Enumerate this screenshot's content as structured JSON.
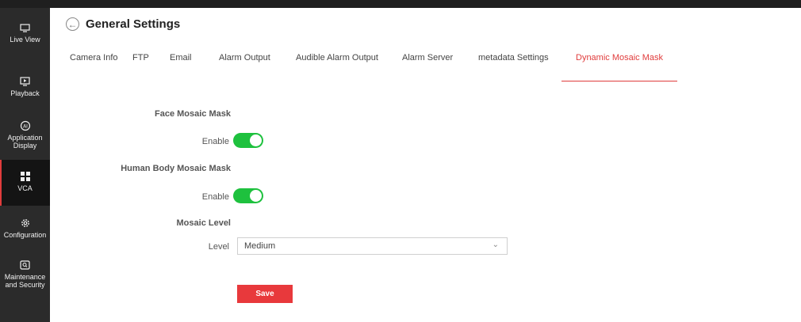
{
  "sidebar": {
    "items": [
      {
        "label_lines": [
          "Live View"
        ],
        "icon": "monitor-icon"
      },
      {
        "label_lines": [
          "Playback"
        ],
        "icon": "playback-icon"
      },
      {
        "label_lines": [
          "Application",
          "Display"
        ],
        "icon": "ai-icon"
      },
      {
        "label_lines": [
          "VCA"
        ],
        "icon": "grid-icon"
      },
      {
        "label_lines": [
          "Configuration"
        ],
        "icon": "gear-icon"
      },
      {
        "label_lines": [
          "Maintenance",
          "and Security"
        ],
        "icon": "shield-icon"
      }
    ],
    "active_index": 3
  },
  "header": {
    "title": "General Settings",
    "back_icon": "back-arrow-icon"
  },
  "tabs": [
    "Camera Info",
    "FTP",
    "Email",
    "Alarm Output",
    "Audible Alarm Output",
    "Alarm Server",
    "metadata Settings",
    "Dynamic Mosaic Mask"
  ],
  "active_tab": "Dynamic Mosaic Mask",
  "form": {
    "face_section": "Face Mosaic Mask",
    "face_enable_label": "Enable",
    "face_enabled": true,
    "body_section": "Human Body Mosaic Mask",
    "body_enable_label": "Enable",
    "body_enabled": true,
    "level_section": "Mosaic Level",
    "level_label": "Level",
    "level_value": "Medium",
    "save_label": "Save"
  },
  "colors": {
    "accent": "#e03c3c",
    "toggle_on": "#1ec13e",
    "sidebar": "#2b2b2b"
  }
}
